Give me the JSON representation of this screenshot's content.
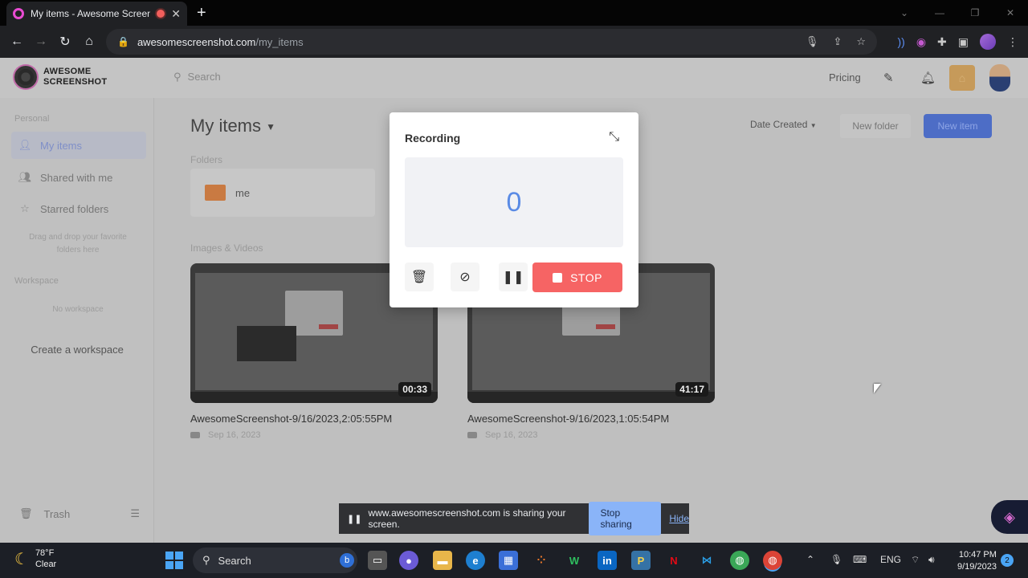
{
  "browser": {
    "tab_title": "My items - Awesome Screenshot",
    "tab_close": "✕",
    "new_tab": "+",
    "url_host": "awesomescreenshot.com",
    "url_path": "/my_items"
  },
  "app": {
    "logo_line1": "AWESOME",
    "logo_line2": "SCREENSHOT",
    "search_placeholder": "Search",
    "pricing": "Pricing"
  },
  "sidebar": {
    "personal_label": "Personal",
    "items": [
      {
        "label": "My items",
        "active": true
      },
      {
        "label": "Shared with me",
        "active": false
      },
      {
        "label": "Starred folders",
        "active": false
      }
    ],
    "starred_hint": "Drag and drop your favorite folders here",
    "workspace_label": "Workspace",
    "no_workspace": "No workspace",
    "create_workspace": "Create a workspace",
    "trash": "Trash"
  },
  "main": {
    "title": "My items",
    "sort_label": "Date Created",
    "new_folder": "New folder",
    "new_item": "New item",
    "folders_label": "Folders",
    "folders": [
      {
        "name": "me"
      }
    ],
    "media_label": "Images & Videos",
    "videos": [
      {
        "title": "AwesomeScreenshot-9/16/2023,2:05:55PM",
        "date": "Sep 16, 2023",
        "duration": "00:33"
      },
      {
        "title": "AwesomeScreenshot-9/16/2023,1:05:54PM",
        "date": "Sep 16, 2023",
        "duration": "41:17"
      }
    ]
  },
  "recording": {
    "title": "Recording",
    "counter": "0",
    "stop_label": "STOP"
  },
  "sharing": {
    "message": "www.awesomescreenshot.com is sharing your screen.",
    "stop_sharing": "Stop sharing",
    "hide": "Hide"
  },
  "taskbar": {
    "temp": "78°F",
    "condition": "Clear",
    "search": "Search",
    "lang": "ENG",
    "time": "10:47 PM",
    "date": "9/19/2023",
    "notifications": "2"
  },
  "colors": {
    "stop_red": "#f66464",
    "counter_blue": "#5a8be5",
    "new_item_blue": "#4d6dc6",
    "share_button": "#8ab4f8"
  }
}
